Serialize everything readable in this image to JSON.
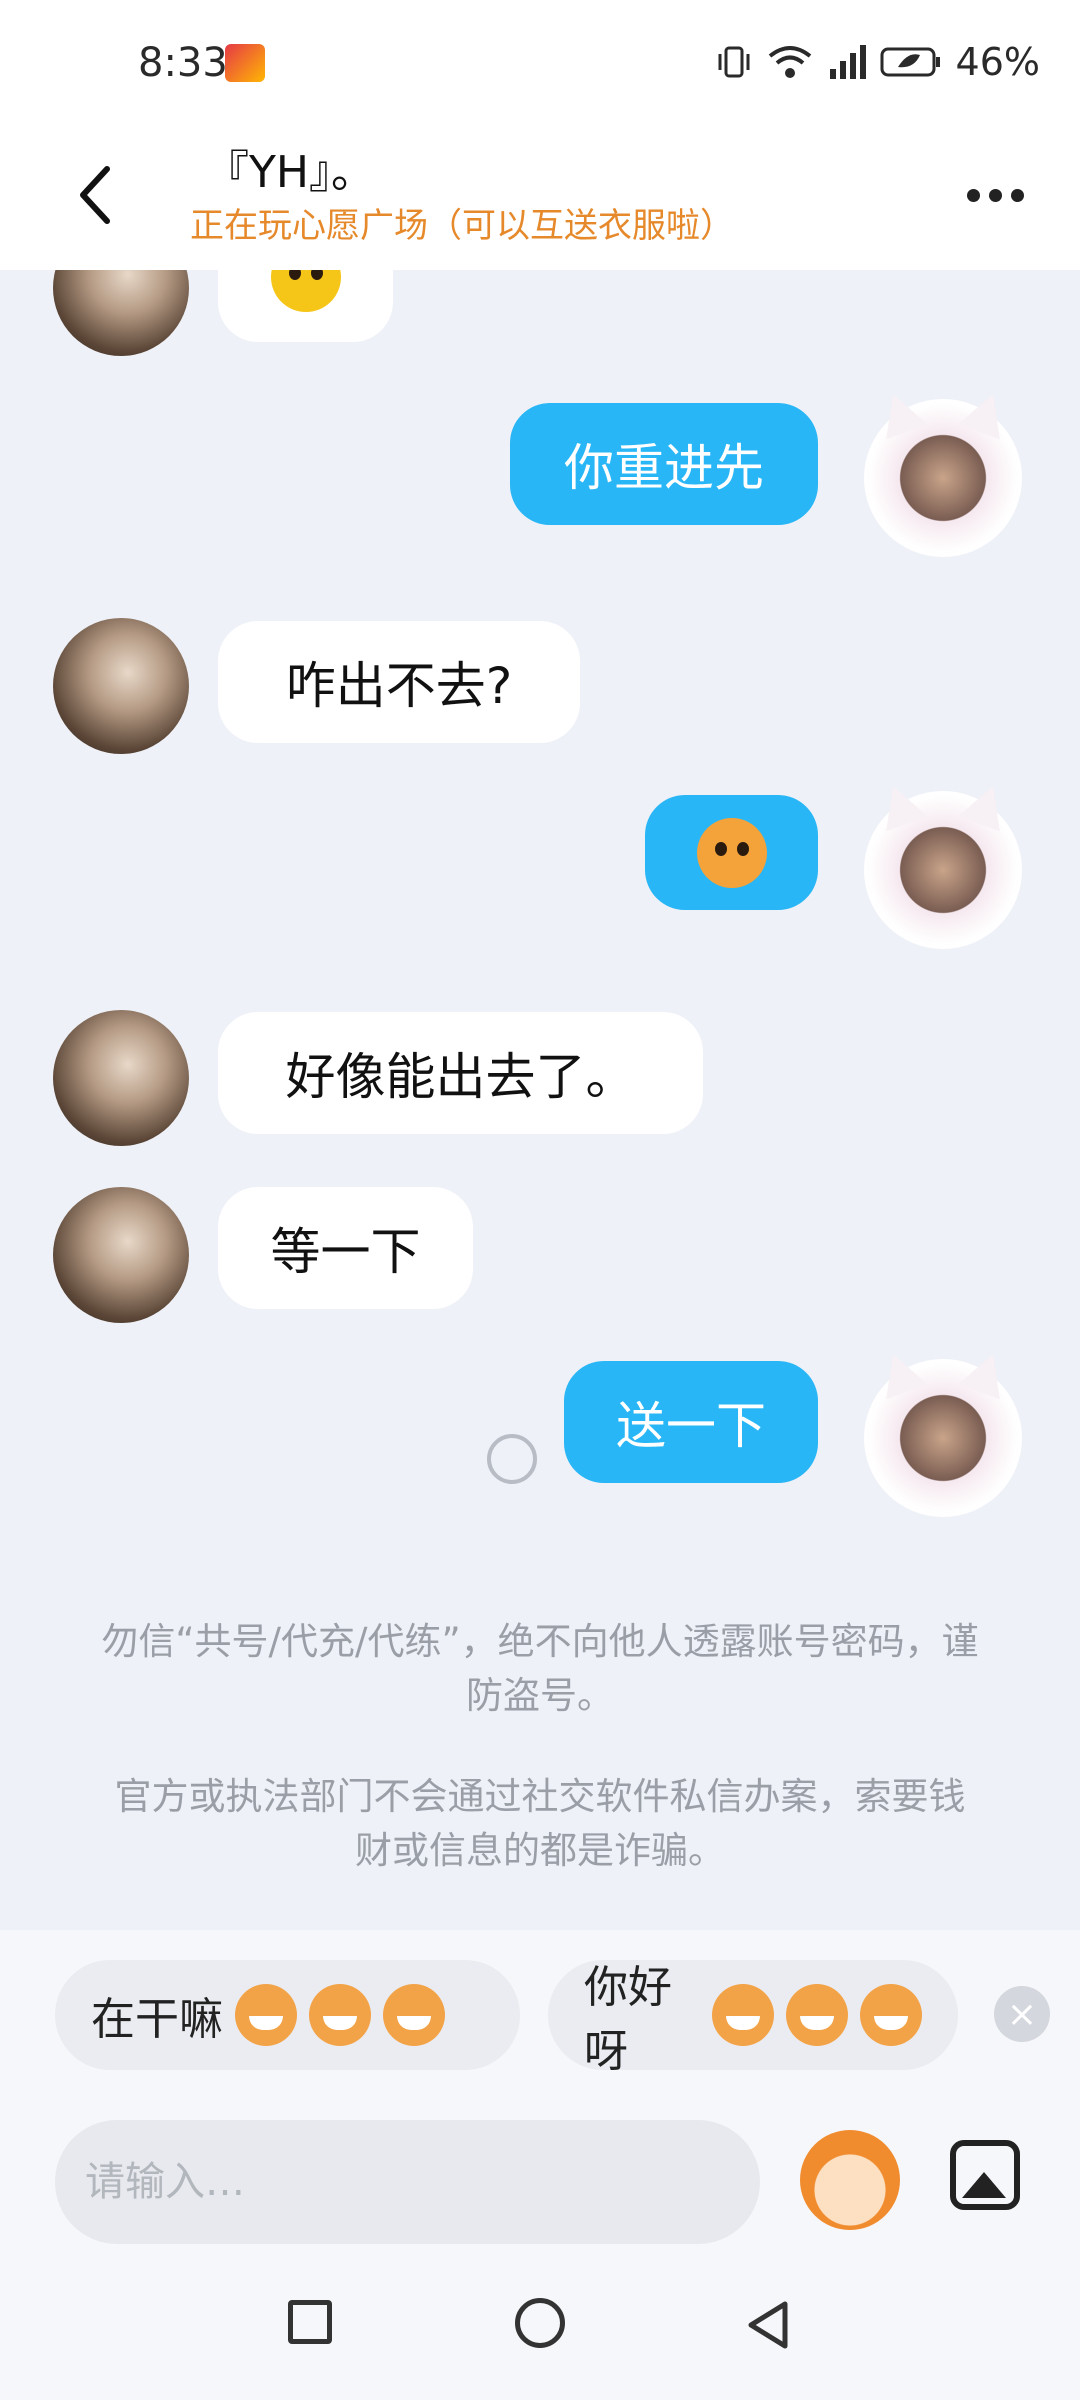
{
  "status_bar": {
    "time": "8:33",
    "battery": "46%"
  },
  "header": {
    "title": "『YH』。",
    "subtitle": "正在玩心愿广场（可以互送衣服啦）"
  },
  "messages": [
    {
      "from": "other",
      "type": "emoji",
      "icon": "yellow-face-emoji"
    },
    {
      "from": "self",
      "type": "text",
      "text": "你重进先"
    },
    {
      "from": "other",
      "type": "text",
      "text": "咋出不去?"
    },
    {
      "from": "self",
      "type": "emoji",
      "icon": "crying-monkey-emoji"
    },
    {
      "from": "other",
      "type": "text",
      "text": "好像能出去了。"
    },
    {
      "from": "other",
      "type": "text",
      "text": "等一下"
    },
    {
      "from": "self",
      "type": "text",
      "text": "送一下",
      "status": "sending"
    }
  ],
  "notices": [
    "勿信“共号/代充/代练”，绝不向他人透露账号密码，谨防盗号。",
    "官方或执法部门不会通过社交软件私信办案，索要钱财或信息的都是诈骗。"
  ],
  "quick_replies": [
    {
      "text": "在干嘛",
      "emoji": "grinning-monkey-emoji"
    },
    {
      "text": "你好呀",
      "emoji": "wide-eyed-monkey-emoji"
    }
  ],
  "input": {
    "placeholder": "请输入…"
  },
  "colors": {
    "self_bubble": "#29b6f6",
    "other_bubble": "#ffffff",
    "subtitle": "#e6892b",
    "background": "#eef1f7"
  }
}
